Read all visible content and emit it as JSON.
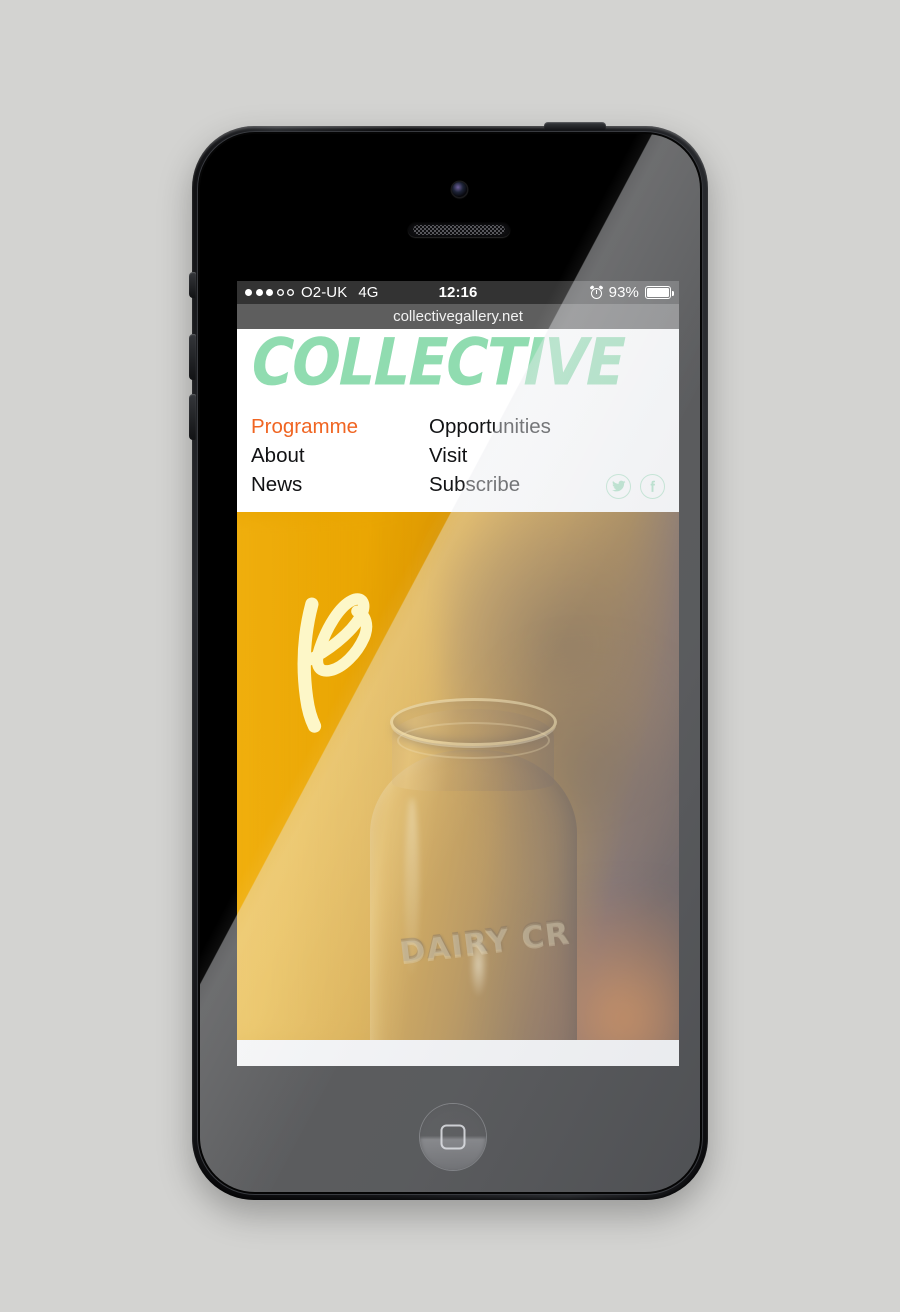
{
  "device": {
    "name": "iPhone 5",
    "body_color": "#111214",
    "home_button_label": "home-button"
  },
  "status_bar": {
    "signal_dots_filled": 3,
    "signal_dots_total": 5,
    "carrier": "O2-UK",
    "network": "4G",
    "clock": "12:16",
    "alarm_icon": "alarm-clock-icon",
    "battery_percent": "93%",
    "battery_level": 93,
    "background": "#333333"
  },
  "browser": {
    "url": "collectivegallery.net",
    "url_bar_background": "#5e5e5e"
  },
  "site": {
    "logo_text": "COLLECTIVE",
    "logo_color": "#90dcb0",
    "accent_color": "#f06522",
    "nav_text_color": "#111214",
    "nav": {
      "column_left": [
        {
          "label": "Programme",
          "active": true
        },
        {
          "label": "About",
          "active": false
        },
        {
          "label": "News",
          "active": false
        }
      ],
      "column_right": [
        {
          "label": "Opportunities",
          "active": false
        },
        {
          "label": "Visit",
          "active": false
        },
        {
          "label": "Subscribe",
          "active": false
        }
      ]
    },
    "social": [
      {
        "name": "twitter-icon",
        "label": "Twitter"
      },
      {
        "name": "facebook-icon",
        "label": "Facebook"
      }
    ],
    "hero": {
      "description": "Close-up photograph of a clear glass milk bottle against a warm amber-orange background",
      "embossed_text": "DAIRY CR",
      "overlay_glyph": "hand-drawn-p-glyph",
      "overlay_glyph_color": "#fdf7c8",
      "background_color": "#e8a400"
    }
  },
  "page": {
    "background_color": "#d3d3d1"
  }
}
